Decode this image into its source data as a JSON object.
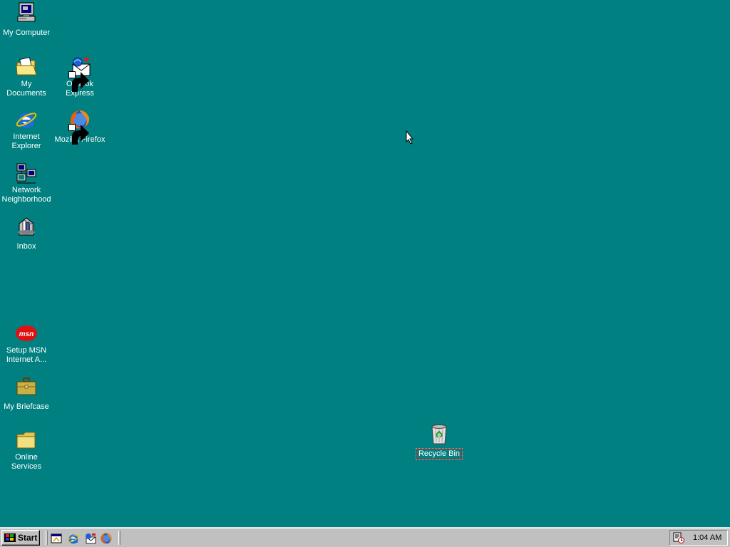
{
  "desktop": {
    "background_color": "#008080",
    "icons": {
      "my_computer": "My Computer",
      "my_documents": "My Documents",
      "outlook_express": "Outlook Express",
      "internet_explorer": "Internet Explorer",
      "mozilla_firefox": "Mozilla Firefox",
      "network_neighborhood": "Network Neighborhood",
      "inbox": "Inbox",
      "setup_msn": "Setup MSN Internet A...",
      "my_briefcase": "My Briefcase",
      "online_services": "Online Services",
      "recycle_bin": "Recycle Bin"
    }
  },
  "taskbar": {
    "start_label": "Start",
    "quick_launch": [
      "desktop-icon",
      "internet-explorer-icon",
      "outlook-express-icon",
      "firefox-icon"
    ],
    "tray": {
      "clock": "1:04 AM",
      "icon": "scheduler-icon"
    }
  }
}
